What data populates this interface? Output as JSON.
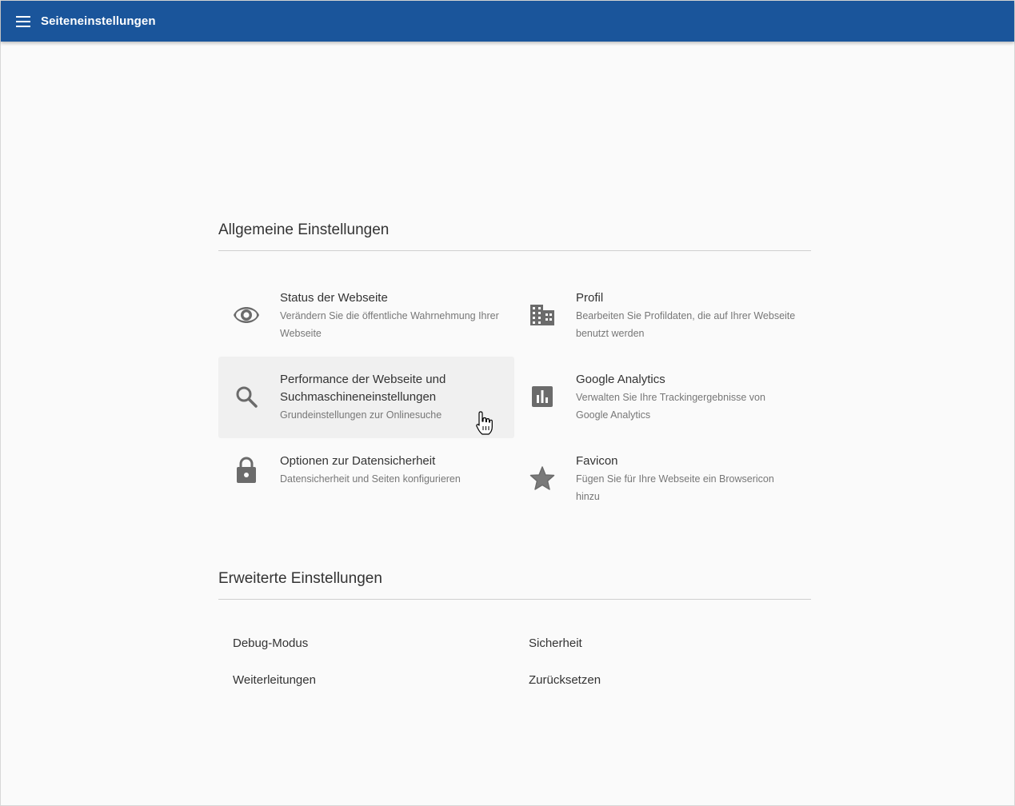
{
  "appbar": {
    "title": "Seiteneinstellungen",
    "menu_icon": "hamburger-menu-icon",
    "background": "#1a559b"
  },
  "general": {
    "title": "Allgemeine Einstellungen",
    "items": [
      {
        "icon": "eye-icon",
        "title": "Status der Webseite",
        "description": "Verändern Sie die öffentliche Wahrnehmung Ihrer Webseite"
      },
      {
        "icon": "building-icon",
        "title": "Profil",
        "description": "Bearbeiten Sie Profildaten, die auf Ihrer Webseite benutzt werden"
      },
      {
        "icon": "search-icon",
        "title": "Performance der Webseite und Suchmaschineneinstellungen",
        "description": "Grundeinstellungen zur Onlinesuche"
      },
      {
        "icon": "bar-chart-icon",
        "title": "Google Analytics",
        "description": "Verwalten Sie Ihre Trackingergebnisse von Google Analytics"
      },
      {
        "icon": "lock-icon",
        "title": "Optionen zur Datensicherheit",
        "description": "Datensicherheit und Seiten konfigurieren"
      },
      {
        "icon": "star-icon",
        "title": "Favicon",
        "description": "Fügen Sie für Ihre Webseite ein Browsericon hinzu"
      }
    ]
  },
  "advanced": {
    "title": "Erweiterte Einstellungen",
    "items": [
      "Debug-Modus",
      "Sicherheit",
      "Weiterleitungen",
      "Zurücksetzen"
    ]
  }
}
